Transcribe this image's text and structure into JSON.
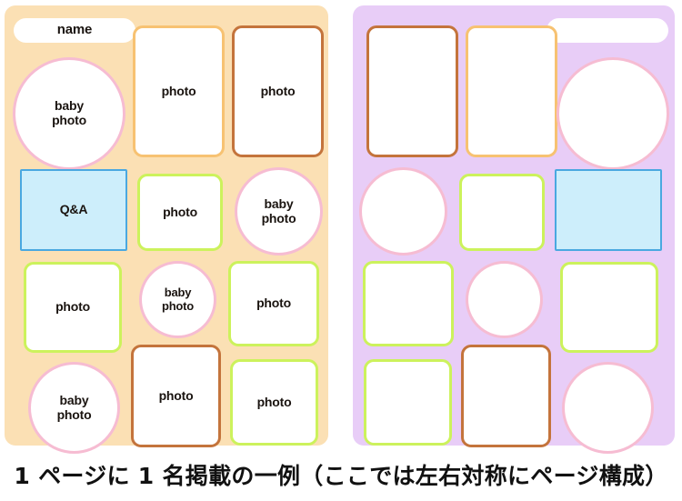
{
  "caption": "1 ページに 1 名掲載の一例（ここでは左右対称にページ構成）",
  "colors": {
    "left_page_bg": "#fbe0b4",
    "right_page_bg": "#e8cdf7",
    "border_orange": "#f7c272",
    "border_brown": "#c4743c",
    "border_pink": "#f6bcd2",
    "border_green": "#ccf25c",
    "border_blue": "#4aa8e0",
    "fill_blue": "#cdeefb",
    "fill_white": "#ffffff",
    "text": "#1a1410"
  },
  "labels": {
    "name": "name",
    "photo": "photo",
    "baby_photo": "baby\nphoto",
    "qa": "Q&A",
    "blank": ""
  },
  "left_page": {
    "title": "left-page",
    "slots": [
      {
        "id": "name-pill",
        "label": "name",
        "shape": "pill",
        "border": "none"
      },
      {
        "id": "photo-r1c2",
        "label": "photo",
        "shape": "rect",
        "border": "orange"
      },
      {
        "id": "photo-r1c3",
        "label": "photo",
        "shape": "rect",
        "border": "brown"
      },
      {
        "id": "baby-photo-r1c1",
        "label": "baby photo",
        "shape": "circle",
        "border": "pink"
      },
      {
        "id": "qa-r2c1",
        "label": "Q&A",
        "shape": "rect",
        "border": "blue"
      },
      {
        "id": "photo-r2c2",
        "label": "photo",
        "shape": "rect",
        "border": "green"
      },
      {
        "id": "baby-photo-r2c3",
        "label": "baby photo",
        "shape": "circle",
        "border": "pink"
      },
      {
        "id": "photo-r3c1",
        "label": "photo",
        "shape": "rect",
        "border": "green"
      },
      {
        "id": "baby-photo-r3c2",
        "label": "baby photo",
        "shape": "circle",
        "border": "pink"
      },
      {
        "id": "photo-r3c3",
        "label": "photo",
        "shape": "rect",
        "border": "green"
      },
      {
        "id": "baby-photo-r4c1",
        "label": "baby photo",
        "shape": "circle",
        "border": "pink"
      },
      {
        "id": "photo-r4c2",
        "label": "photo",
        "shape": "rect",
        "border": "brown"
      },
      {
        "id": "photo-r4c3",
        "label": "photo",
        "shape": "rect",
        "border": "green"
      }
    ]
  },
  "right_page": {
    "title": "right-page",
    "slots": [
      {
        "id": "blank-pill",
        "label": "",
        "shape": "pill",
        "border": "none"
      },
      {
        "id": "blank-r1c1",
        "label": "",
        "shape": "rect",
        "border": "brown"
      },
      {
        "id": "blank-r1c2",
        "label": "",
        "shape": "rect",
        "border": "orange"
      },
      {
        "id": "blank-circle-r1c3",
        "label": "",
        "shape": "circle",
        "border": "pink"
      },
      {
        "id": "blank-circle-r2c1",
        "label": "",
        "shape": "circle",
        "border": "pink"
      },
      {
        "id": "blank-r2c2",
        "label": "",
        "shape": "rect",
        "border": "green"
      },
      {
        "id": "blank-r2c3",
        "label": "",
        "shape": "rect",
        "border": "blue"
      },
      {
        "id": "blank-r3c1",
        "label": "",
        "shape": "rect",
        "border": "green"
      },
      {
        "id": "blank-circle-r3c2",
        "label": "",
        "shape": "circle",
        "border": "pink"
      },
      {
        "id": "blank-r3c3",
        "label": "",
        "shape": "rect",
        "border": "green"
      },
      {
        "id": "blank-r4c1",
        "label": "",
        "shape": "rect",
        "border": "green"
      },
      {
        "id": "blank-r4c2",
        "label": "",
        "shape": "rect",
        "border": "brown"
      },
      {
        "id": "blank-circle-r4c3",
        "label": "",
        "shape": "circle",
        "border": "pink"
      }
    ]
  }
}
